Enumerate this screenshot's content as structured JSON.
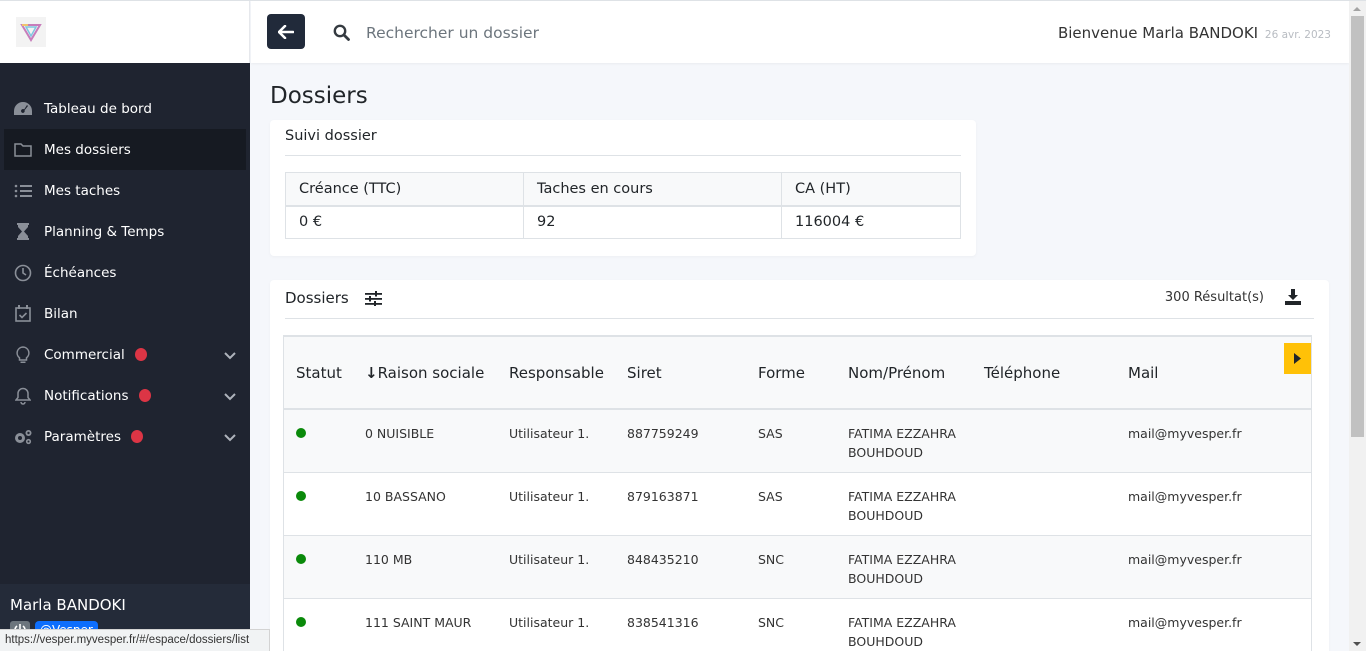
{
  "sidebar": {
    "logo_alt": "Vesper logo",
    "items": [
      {
        "label": "Tableau de bord",
        "icon": "dashboard-gauge-icon",
        "active": false
      },
      {
        "label": "Mes dossiers",
        "icon": "folder-icon",
        "active": true
      },
      {
        "label": "Mes taches",
        "icon": "task-list-icon",
        "active": false
      },
      {
        "label": "Planning & Temps",
        "icon": "hourglass-icon",
        "active": false
      },
      {
        "label": "Échéances",
        "icon": "clock-icon",
        "active": false
      },
      {
        "label": "Bilan",
        "icon": "calendar-check-icon",
        "active": false
      },
      {
        "label": "Commercial",
        "icon": "lightbulb-icon",
        "active": false,
        "badge": true,
        "expandable": true
      },
      {
        "label": "Notifications",
        "icon": "bell-icon",
        "active": false,
        "badge": true,
        "expandable": true
      },
      {
        "label": "Paramètres",
        "icon": "gears-icon",
        "active": false,
        "badge": true,
        "expandable": true
      }
    ],
    "user": {
      "name": "Marla BANDOKI",
      "tag": "@Vesper"
    }
  },
  "header": {
    "search_placeholder": "Rechercher un dossier",
    "welcome": "Bienvenue Marla BANDOKI",
    "date": "26 avr. 2023"
  },
  "page": {
    "title": "Dossiers",
    "suivi": {
      "title": "Suivi dossier",
      "headers": [
        "Créance (TTC)",
        "Taches en cours",
        "CA (HT)"
      ],
      "values": [
        "0 €",
        "92",
        "116004 €"
      ]
    },
    "dossiers": {
      "title": "Dossiers",
      "results": "300 Résultat(s)",
      "columns": [
        "Statut",
        "Raison sociale",
        "Responsable",
        "Siret",
        "Forme",
        "Nom/Prénom",
        "Téléphone",
        "Mail"
      ],
      "sort_indicator": "↓",
      "rows": [
        {
          "status": "active",
          "raison": "0 NUISIBLE",
          "responsable": "Utilisateur 1.",
          "siret": "887759249",
          "forme": "SAS",
          "nom": "FATIMA EZZAHRA BOUHDOUD",
          "telephone": "",
          "mail": "mail@myvesper.fr"
        },
        {
          "status": "active",
          "raison": "10 BASSANO",
          "responsable": "Utilisateur 1.",
          "siret": "879163871",
          "forme": "SAS",
          "nom": "FATIMA EZZAHRA BOUHDOUD",
          "telephone": "",
          "mail": "mail@myvesper.fr"
        },
        {
          "status": "active",
          "raison": "110 MB",
          "responsable": "Utilisateur 1.",
          "siret": "848435210",
          "forme": "SNC",
          "nom": "FATIMA EZZAHRA BOUHDOUD",
          "telephone": "",
          "mail": "mail@myvesper.fr"
        },
        {
          "status": "active",
          "raison": "111 SAINT MAUR",
          "responsable": "Utilisateur 1.",
          "siret": "838541316",
          "forme": "SNC",
          "nom": "FATIMA EZZAHRA BOUHDOUD",
          "telephone": "",
          "mail": "mail@myvesper.fr"
        }
      ]
    }
  },
  "statusbar": {
    "url": "https://vesper.myvesper.fr/#/espace/dossiers/list"
  },
  "colors": {
    "sidebar_bg": "#1f2430",
    "accent_dark": "#212a3a",
    "badge_red": "#dc3545",
    "status_green": "#0a8a0a",
    "next_button": "#ffc107"
  }
}
